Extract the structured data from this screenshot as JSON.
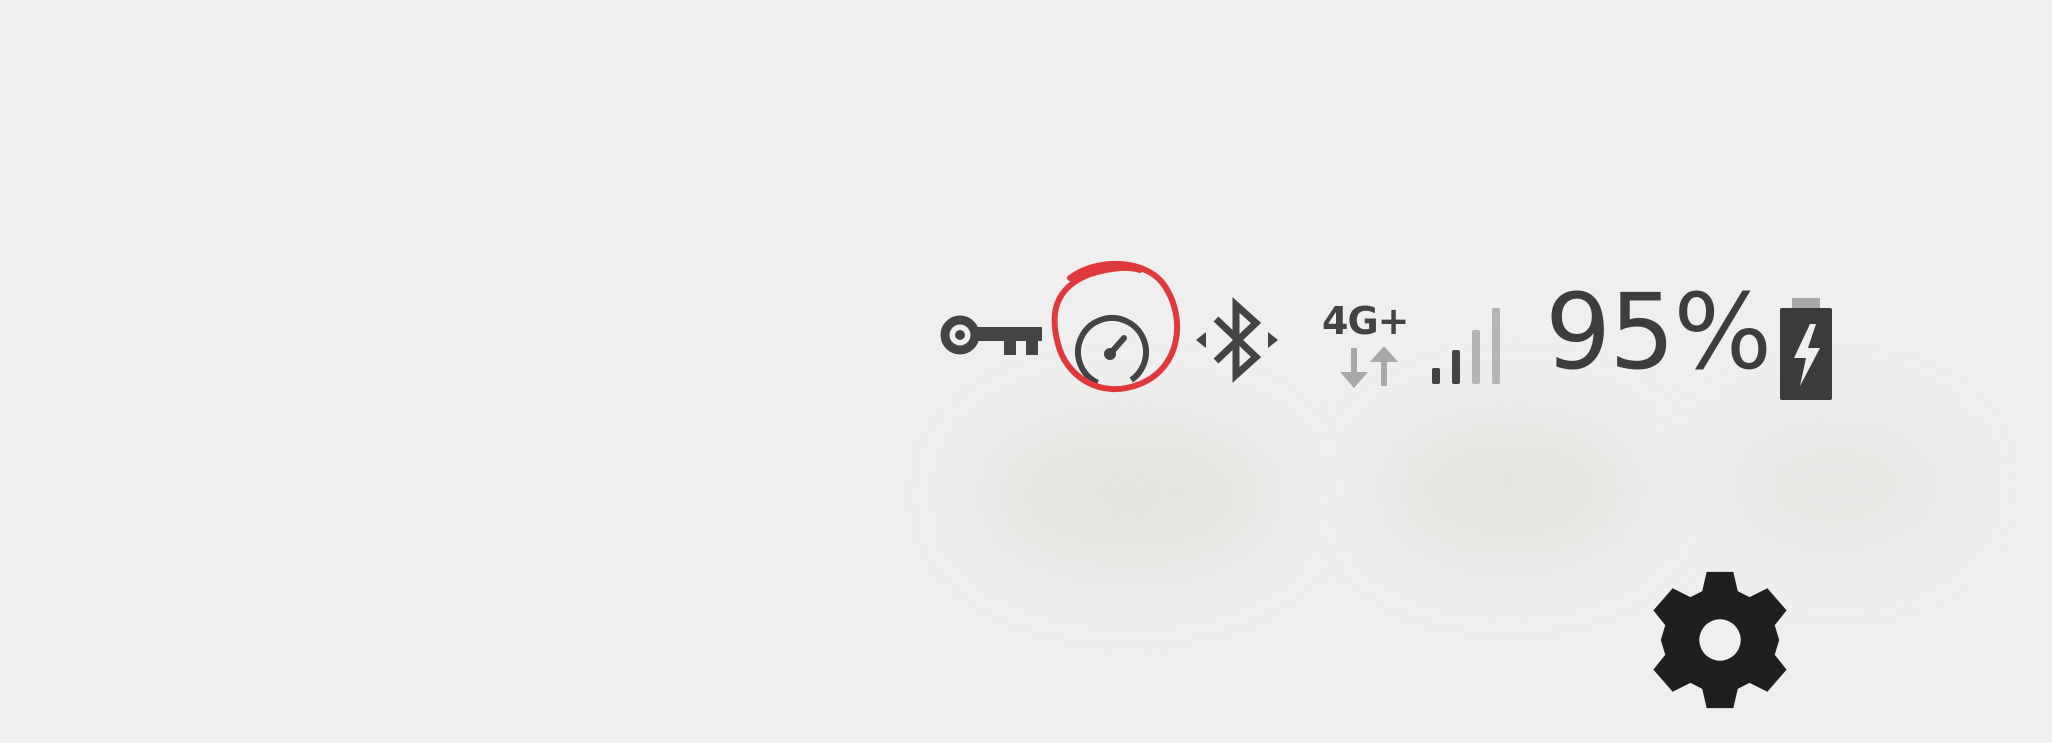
{
  "status_bar": {
    "icons": {
      "vpn": "vpn-key-icon",
      "data_saver": "data-saver-icon",
      "bluetooth": "bluetooth-icon",
      "data_activity": "data-activity-icon",
      "signal": "signal-strength-icon",
      "battery": "battery-charging-icon"
    },
    "network_type": "4G+",
    "battery_percent": "95%",
    "battery_level": 95
  },
  "quick_settings": {
    "settings_icon": "gear-icon"
  },
  "annotation": {
    "highlight_color": "#e0393b",
    "highlighted_icon": "data-saver-icon"
  },
  "colors": {
    "background": "#efefef",
    "icon": "#444444",
    "icon_dim": "#a8a8a8",
    "settings_icon": "#1f1f1f"
  }
}
